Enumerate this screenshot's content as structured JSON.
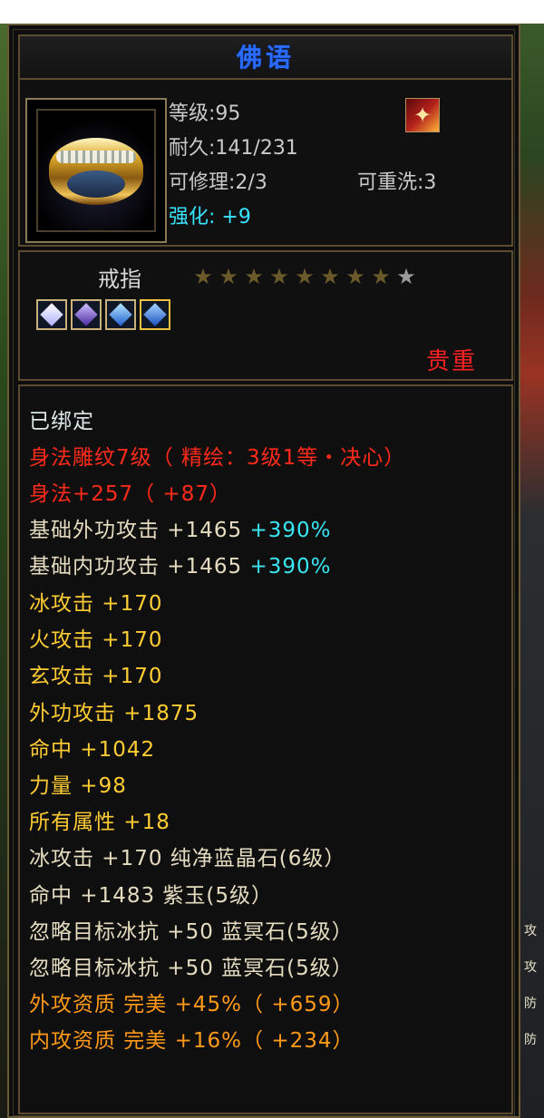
{
  "item": {
    "name": "佛语",
    "level": "等级:95",
    "durability": "耐久:141/231",
    "repairable": "可修理:2/3",
    "rewashable": "可重洗:3",
    "enhance_label": "强化:",
    "enhance_value": "+9",
    "type": "戒指",
    "stars_filled": 8,
    "stars_total": 9,
    "rarity": "贵重",
    "gems": [
      "white-crystal-gem",
      "purple-crystal-gem",
      "blue-crystal-gem",
      "blue-crystal-gem"
    ]
  },
  "attributes": {
    "bound": "已绑定",
    "engrave": "身法雕纹7级（ 精绘：3级1等・决心）",
    "agility": "身法+257（ +87）",
    "base_ext_attack": "基础外功攻击  +1465",
    "base_ext_attack_pct": "+390%",
    "base_int_attack": "基础内功攻击  +1465",
    "base_int_attack_pct": "+390%",
    "ice_attack": "冰攻击  +170",
    "fire_attack": "火攻击  +170",
    "mystic_attack": "玄攻击  +170",
    "ext_attack": "外功攻击  +1875",
    "hit": "命中  +1042",
    "strength": "力量  +98",
    "all_attr": "所有属性  +18",
    "gem1": "冰攻击  +170  纯净蓝晶石(6级）",
    "gem2": "命中  +1483  紫玉(5级）",
    "gem3": "忽略目标冰抗  +50  蓝冥石(5级）",
    "gem4": "忽略目标冰抗  +50  蓝冥石(5级）",
    "ext_quality": "外攻资质   完美  +45%（ +659）",
    "int_quality": "内攻资质   完美  +16%（ +234）"
  },
  "background": {
    "right_chars": [
      "攻",
      "攻",
      "防",
      "防"
    ]
  },
  "colors": {
    "title": "#2a6bff",
    "red": "#ff2a1a",
    "gold": "#ffcc33",
    "orange": "#ff9a18",
    "cyan": "#3ae6f2"
  }
}
